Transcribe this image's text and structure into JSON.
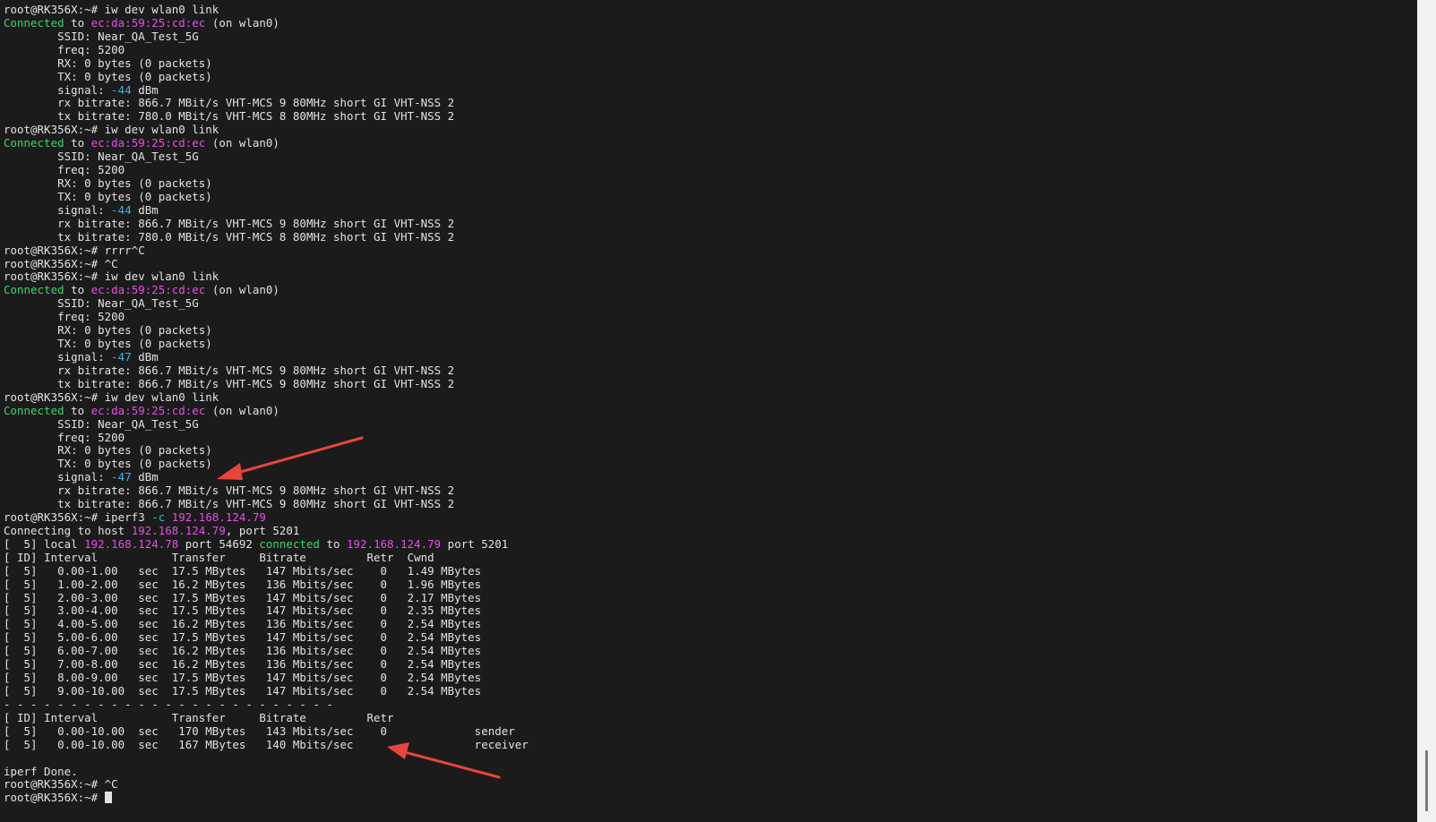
{
  "terminal": {
    "lines": [
      [
        {
          "t": "root@RK356X:~# iw dev wlan0 link"
        }
      ],
      [
        {
          "t": "Connected",
          "c": "green"
        },
        {
          "t": " to "
        },
        {
          "t": "ec:da:59:25:cd:ec",
          "c": "magenta"
        },
        {
          "t": " (on wlan0)"
        }
      ],
      [
        {
          "t": "        SSID: Near_QA_Test_5G"
        }
      ],
      [
        {
          "t": "        freq: 5200"
        }
      ],
      [
        {
          "t": "        RX: 0 bytes (0 packets)"
        }
      ],
      [
        {
          "t": "        TX: 0 bytes (0 packets)"
        }
      ],
      [
        {
          "t": "        signal: "
        },
        {
          "t": "-44",
          "c": "cyan"
        },
        {
          "t": " dBm"
        }
      ],
      [
        {
          "t": "        rx bitrate: 866.7 MBit/s VHT-MCS 9 80MHz short GI VHT-NSS 2"
        }
      ],
      [
        {
          "t": "        tx bitrate: 780.0 MBit/s VHT-MCS 8 80MHz short GI VHT-NSS 2"
        }
      ],
      [
        {
          "t": "root@RK356X:~# iw dev wlan0 link"
        }
      ],
      [
        {
          "t": "Connected",
          "c": "green"
        },
        {
          "t": " to "
        },
        {
          "t": "ec:da:59:25:cd:ec",
          "c": "magenta"
        },
        {
          "t": " (on wlan0)"
        }
      ],
      [
        {
          "t": "        SSID: Near_QA_Test_5G"
        }
      ],
      [
        {
          "t": "        freq: 5200"
        }
      ],
      [
        {
          "t": "        RX: 0 bytes (0 packets)"
        }
      ],
      [
        {
          "t": "        TX: 0 bytes (0 packets)"
        }
      ],
      [
        {
          "t": "        signal: "
        },
        {
          "t": "-44",
          "c": "cyan"
        },
        {
          "t": " dBm"
        }
      ],
      [
        {
          "t": "        rx bitrate: 866.7 MBit/s VHT-MCS 9 80MHz short GI VHT-NSS 2"
        }
      ],
      [
        {
          "t": "        tx bitrate: 780.0 MBit/s VHT-MCS 8 80MHz short GI VHT-NSS 2"
        }
      ],
      [
        {
          "t": "root@RK356X:~# rrrr^C"
        }
      ],
      [
        {
          "t": "root@RK356X:~# ^C"
        }
      ],
      [
        {
          "t": "root@RK356X:~# iw dev wlan0 link"
        }
      ],
      [
        {
          "t": "Connected",
          "c": "green"
        },
        {
          "t": " to "
        },
        {
          "t": "ec:da:59:25:cd:ec",
          "c": "magenta"
        },
        {
          "t": " (on wlan0)"
        }
      ],
      [
        {
          "t": "        SSID: Near_QA_Test_5G"
        }
      ],
      [
        {
          "t": "        freq: 5200"
        }
      ],
      [
        {
          "t": "        RX: 0 bytes (0 packets)"
        }
      ],
      [
        {
          "t": "        TX: 0 bytes (0 packets)"
        }
      ],
      [
        {
          "t": "        signal: "
        },
        {
          "t": "-47",
          "c": "cyan"
        },
        {
          "t": " dBm"
        }
      ],
      [
        {
          "t": "        rx bitrate: 866.7 MBit/s VHT-MCS 9 80MHz short GI VHT-NSS 2"
        }
      ],
      [
        {
          "t": "        tx bitrate: 866.7 MBit/s VHT-MCS 9 80MHz short GI VHT-NSS 2"
        }
      ],
      [
        {
          "t": "root@RK356X:~# iw dev wlan0 link"
        }
      ],
      [
        {
          "t": "Connected",
          "c": "green"
        },
        {
          "t": " to "
        },
        {
          "t": "ec:da:59:25:cd:ec",
          "c": "magenta"
        },
        {
          "t": " (on wlan0)"
        }
      ],
      [
        {
          "t": "        SSID: Near_QA_Test_5G"
        }
      ],
      [
        {
          "t": "        freq: 5200"
        }
      ],
      [
        {
          "t": "        RX: 0 bytes (0 packets)"
        }
      ],
      [
        {
          "t": "        TX: 0 bytes (0 packets)"
        }
      ],
      [
        {
          "t": "        signal: "
        },
        {
          "t": "-47",
          "c": "cyan"
        },
        {
          "t": " dBm"
        }
      ],
      [
        {
          "t": "        rx bitrate: 866.7 MBit/s VHT-MCS 9 80MHz short GI VHT-NSS 2"
        }
      ],
      [
        {
          "t": "        tx bitrate: 866.7 MBit/s VHT-MCS 9 80MHz short GI VHT-NSS 2"
        }
      ],
      [
        {
          "t": "root@RK356X:~# iperf3 "
        },
        {
          "t": "-c",
          "c": "cyan"
        },
        {
          "t": " "
        },
        {
          "t": "192.168.124.79",
          "c": "magenta"
        }
      ],
      [
        {
          "t": "Connecting to host "
        },
        {
          "t": "192.168.124.79",
          "c": "magenta"
        },
        {
          "t": ", port 5201"
        }
      ],
      [
        {
          "t": "[  5] local "
        },
        {
          "t": "192.168.124.78",
          "c": "magenta"
        },
        {
          "t": " port 54692 "
        },
        {
          "t": "connected",
          "c": "green"
        },
        {
          "t": " to "
        },
        {
          "t": "192.168.124.79",
          "c": "magenta"
        },
        {
          "t": " port 5201"
        }
      ],
      [
        {
          "t": "[ ID] Interval           Transfer     Bitrate         Retr  Cwnd"
        }
      ],
      [
        {
          "t": "[  5]   0.00-1.00   sec  17.5 MBytes   147 Mbits/sec    0   1.49 MBytes"
        }
      ],
      [
        {
          "t": "[  5]   1.00-2.00   sec  16.2 MBytes   136 Mbits/sec    0   1.96 MBytes"
        }
      ],
      [
        {
          "t": "[  5]   2.00-3.00   sec  17.5 MBytes   147 Mbits/sec    0   2.17 MBytes"
        }
      ],
      [
        {
          "t": "[  5]   3.00-4.00   sec  17.5 MBytes   147 Mbits/sec    0   2.35 MBytes"
        }
      ],
      [
        {
          "t": "[  5]   4.00-5.00   sec  16.2 MBytes   136 Mbits/sec    0   2.54 MBytes"
        }
      ],
      [
        {
          "t": "[  5]   5.00-6.00   sec  17.5 MBytes   147 Mbits/sec    0   2.54 MBytes"
        }
      ],
      [
        {
          "t": "[  5]   6.00-7.00   sec  16.2 MBytes   136 Mbits/sec    0   2.54 MBytes"
        }
      ],
      [
        {
          "t": "[  5]   7.00-8.00   sec  16.2 MBytes   136 Mbits/sec    0   2.54 MBytes"
        }
      ],
      [
        {
          "t": "[  5]   8.00-9.00   sec  17.5 MBytes   147 Mbits/sec    0   2.54 MBytes"
        }
      ],
      [
        {
          "t": "[  5]   9.00-10.00  sec  17.5 MBytes   147 Mbits/sec    0   2.54 MBytes"
        }
      ],
      [
        {
          "t": "- - - - - - - - - - - - - - - - - - - - - - - - -"
        }
      ],
      [
        {
          "t": "[ ID] Interval           Transfer     Bitrate         Retr"
        }
      ],
      [
        {
          "t": "[  5]   0.00-10.00  sec   170 MBytes   143 Mbits/sec    0             sender"
        }
      ],
      [
        {
          "t": "[  5]   0.00-10.00  sec   167 MBytes   140 Mbits/sec                  receiver"
        }
      ],
      [
        {
          "t": ""
        }
      ],
      [
        {
          "t": "iperf Done."
        }
      ],
      [
        {
          "t": "root@RK356X:~# ^C"
        }
      ],
      [
        {
          "t": "root@RK356X:~# "
        }
      ]
    ]
  },
  "colors": {
    "background": "#1b1b1b",
    "foreground": "#e3e3e3",
    "green": "#3ed36a",
    "magenta": "#e64fe6",
    "cyan": "#3fb4e6",
    "annotation_arrow": "#e8453c",
    "scrollbar": "#f2f2f2"
  },
  "icons": {
    "annotation_1": "red-arrow-icon",
    "annotation_2": "red-arrow-icon",
    "cursor": "block-cursor-icon"
  }
}
